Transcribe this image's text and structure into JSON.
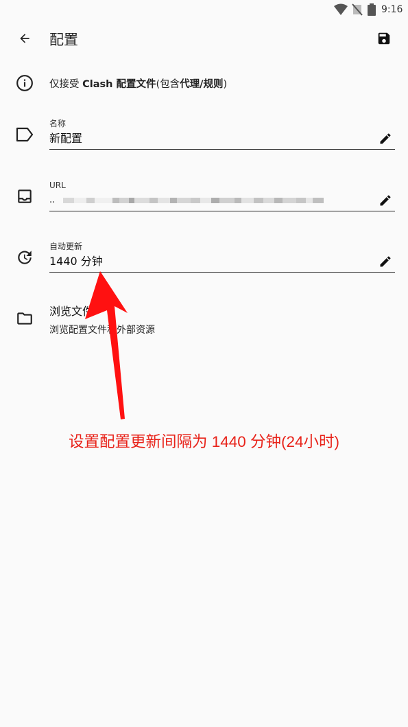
{
  "status_bar": {
    "time": "9:16",
    "icons": [
      "wifi-icon",
      "no-signal-icon",
      "battery-icon"
    ]
  },
  "toolbar": {
    "title": "配置",
    "back_icon": "arrow-back-icon",
    "save_icon": "save-icon"
  },
  "notice": {
    "icon": "info-icon",
    "prefix": "仅接受 ",
    "bold1": "Clash 配置文件",
    "middle": "(包含",
    "bold2": "代理/规则",
    "suffix": ")"
  },
  "fields": {
    "name": {
      "label": "名称",
      "value": "新配置",
      "icon": "label-tag-icon"
    },
    "url": {
      "label": "URL",
      "value": "..",
      "icon": "inbox-icon"
    },
    "auto_update": {
      "label": "自动更新",
      "value": "1440 分钟",
      "icon": "update-icon"
    }
  },
  "browse": {
    "title": "浏览文件",
    "subtitle": "浏览配置文件和外部资源",
    "icon": "folder-icon"
  },
  "annotation": {
    "text": "设置配置更新间隔为 1440 分钟(24小时)",
    "color": "#e8231a"
  }
}
